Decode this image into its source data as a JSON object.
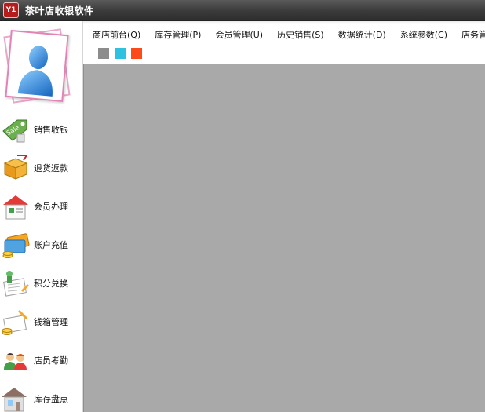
{
  "window": {
    "title": "茶叶店收银软件",
    "icon_text": "Y1"
  },
  "menubar": {
    "menus": [
      "商店前台(Q)",
      "库存管理(P)",
      "会员管理(U)",
      "历史销售(S)",
      "数据统计(D)",
      "系统参数(C)",
      "店务管理("
    ],
    "theme_swatches": [
      "#8c8c8c",
      "#2ec1e0",
      "#fc4a1a"
    ]
  },
  "sidebar": {
    "avatar_icon": "user-avatar-icon",
    "items": [
      {
        "label": "销售收银",
        "icon": "sale-tag-icon"
      },
      {
        "label": "退货返款",
        "icon": "return-box-icon"
      },
      {
        "label": "会员办理",
        "icon": "member-card-icon"
      },
      {
        "label": "账户充值",
        "icon": "account-recharge-icon"
      },
      {
        "label": "积分兑换",
        "icon": "points-exchange-icon"
      },
      {
        "label": "钱箱管理",
        "icon": "cash-drawer-icon"
      },
      {
        "label": "店员考勤",
        "icon": "staff-attendance-icon"
      },
      {
        "label": "库存盘点",
        "icon": "inventory-house-icon"
      }
    ]
  }
}
